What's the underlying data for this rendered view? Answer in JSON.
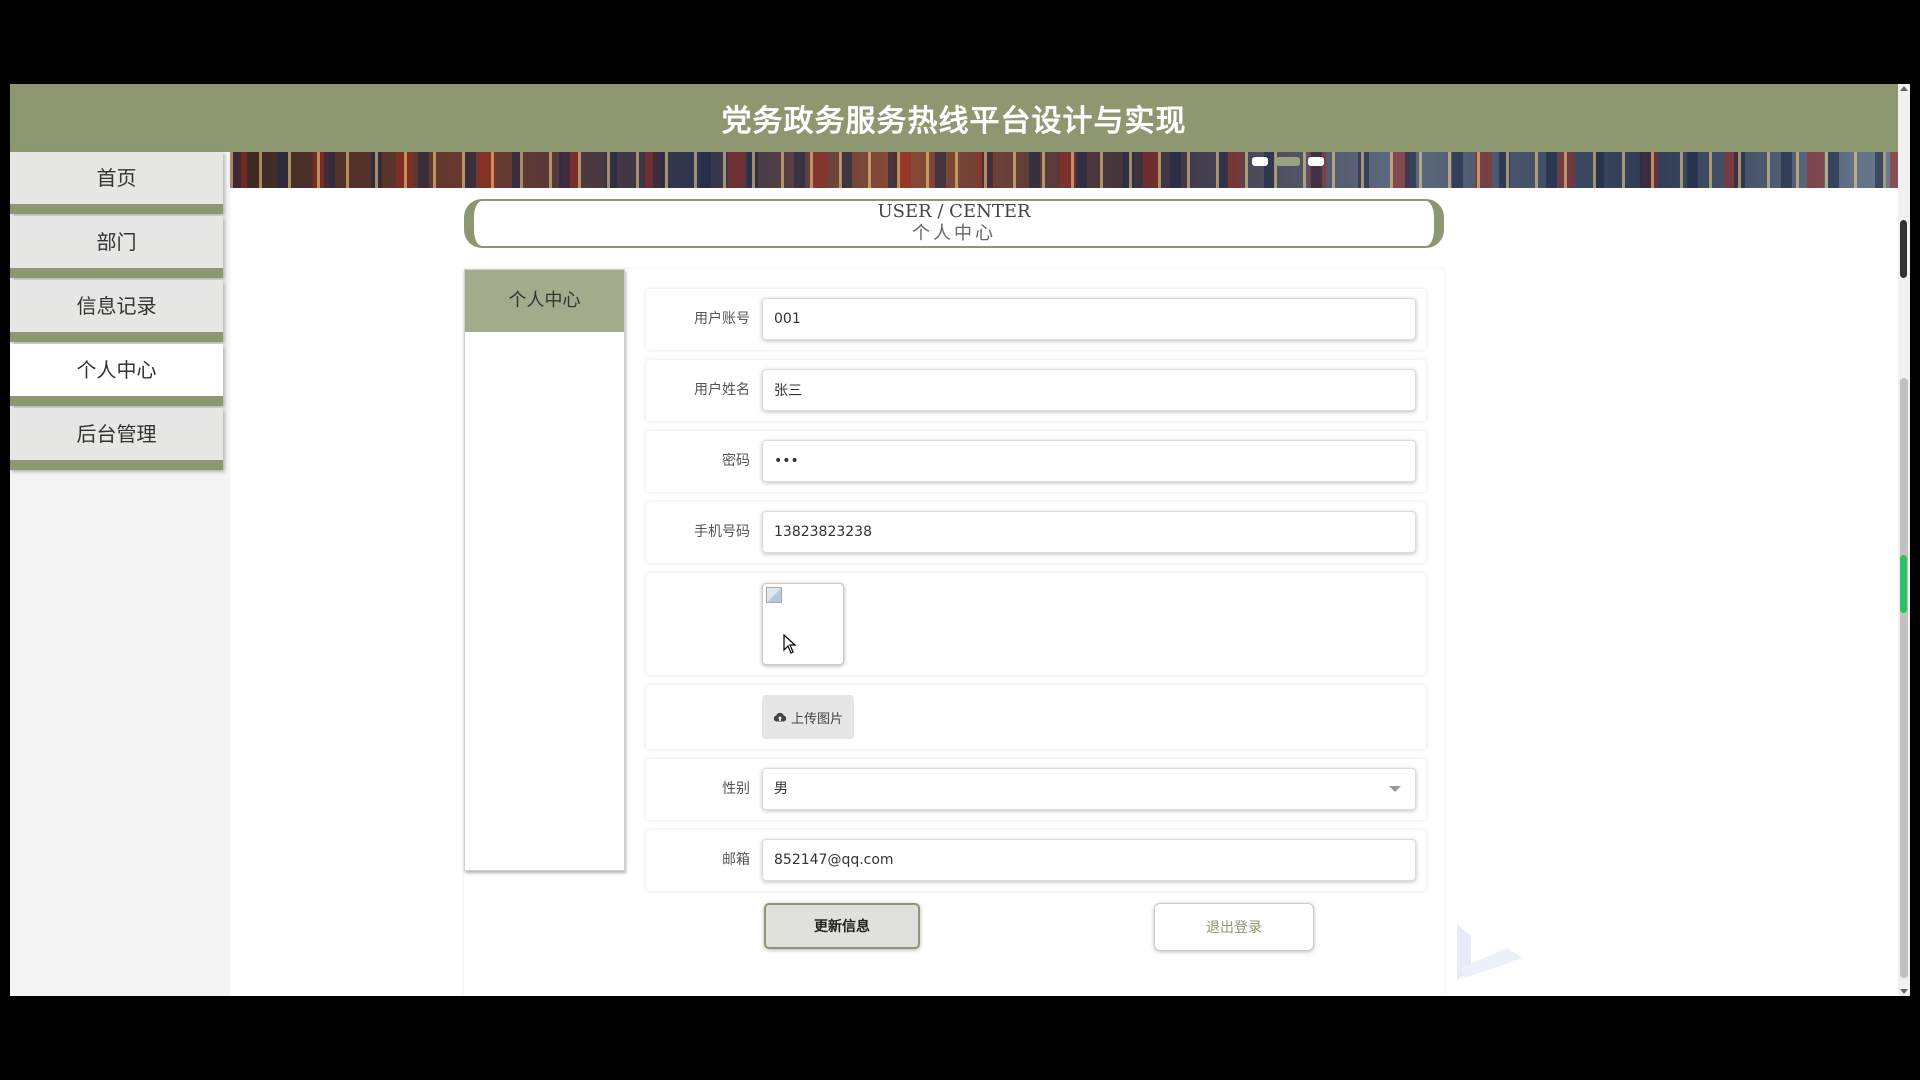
{
  "header": {
    "title": "党务政务服务热线平台设计与实现"
  },
  "sidebar": {
    "items": [
      {
        "label": "首页"
      },
      {
        "label": "部门"
      },
      {
        "label": "信息记录"
      },
      {
        "label": "个人中心"
      },
      {
        "label": "后台管理"
      }
    ],
    "active": "个人中心"
  },
  "banner": {
    "slide_count": 3,
    "active_index": 1
  },
  "section": {
    "title_en": "USER / CENTER",
    "title_cn": "个人中心"
  },
  "left_menu": {
    "items": [
      {
        "label": "个人中心"
      }
    ]
  },
  "form": {
    "account": {
      "label": "用户账号",
      "value": "001"
    },
    "name": {
      "label": "用户姓名",
      "value": "张三"
    },
    "password": {
      "label": "密码",
      "value": "123"
    },
    "phone": {
      "label": "手机号码",
      "value": "13823823238"
    },
    "upload_label": "上传图片",
    "gender": {
      "label": "性别",
      "value": "男"
    },
    "email": {
      "label": "邮箱",
      "value": "852147@qq.com"
    }
  },
  "actions": {
    "update_label": "更新信息",
    "logout_label": "退出登录"
  },
  "colors": {
    "accent": "#8e9870",
    "accent_light": "#a3ab8c",
    "background": "#ffffff"
  }
}
